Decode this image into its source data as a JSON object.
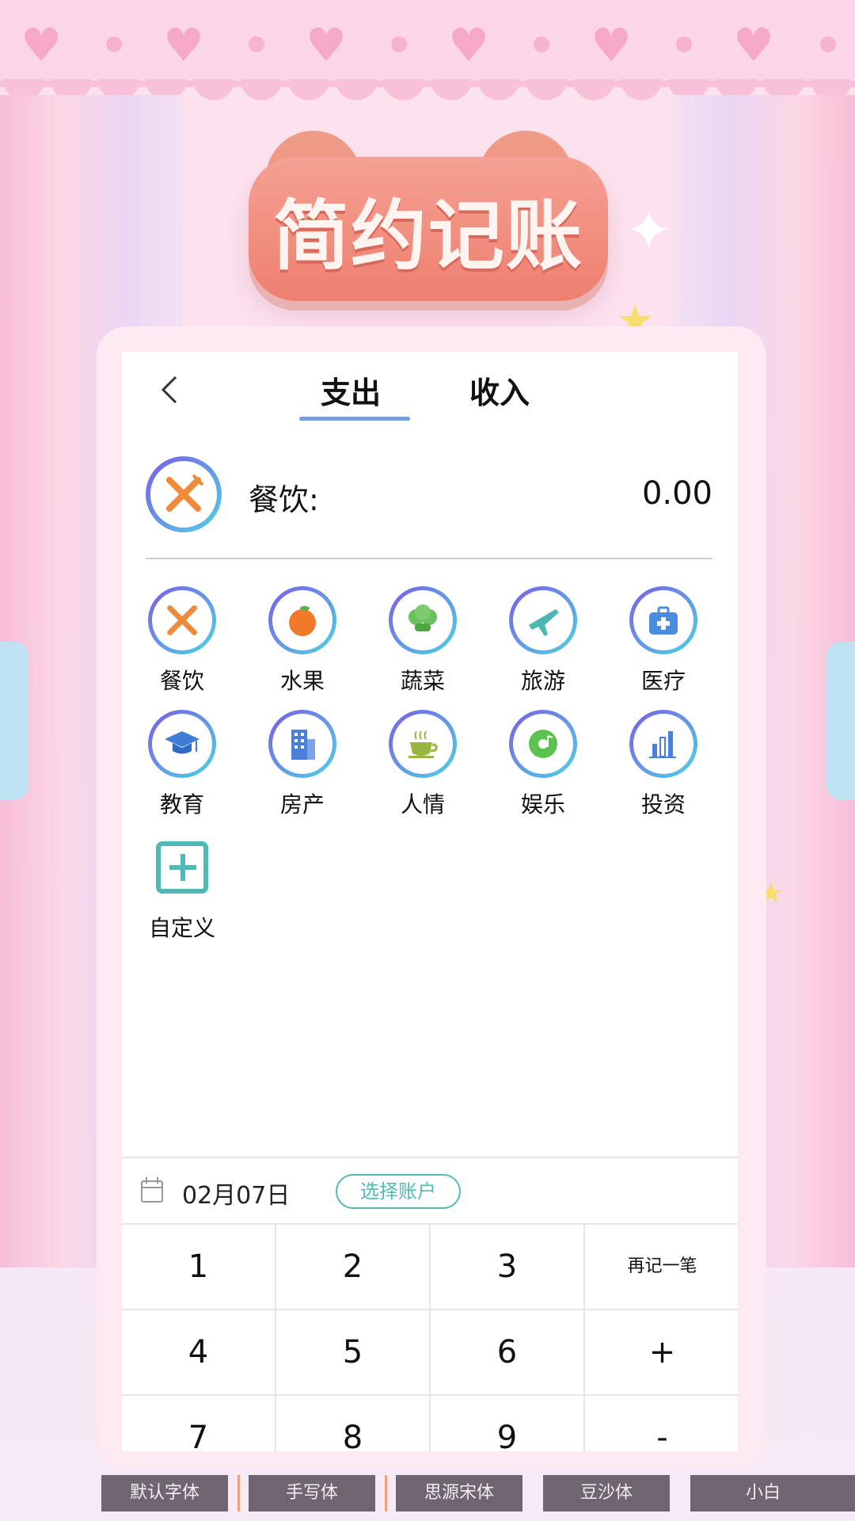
{
  "app": {
    "title": "简约记账"
  },
  "tabs": {
    "expense": "支出",
    "income": "收入",
    "active": "expense"
  },
  "selected": {
    "label": "餐饮:",
    "amount": "0.00",
    "icon": "fork-knife-icon"
  },
  "categories": [
    {
      "label": "餐饮",
      "icon": "fork-knife-icon"
    },
    {
      "label": "水果",
      "icon": "orange-icon"
    },
    {
      "label": "蔬菜",
      "icon": "vegetable-icon"
    },
    {
      "label": "旅游",
      "icon": "airplane-icon"
    },
    {
      "label": "医疗",
      "icon": "medical-kit-icon"
    },
    {
      "label": "教育",
      "icon": "graduation-cap-icon"
    },
    {
      "label": "房产",
      "icon": "building-icon"
    },
    {
      "label": "人情",
      "icon": "tea-cup-icon"
    },
    {
      "label": "娱乐",
      "icon": "music-disc-icon"
    },
    {
      "label": "投资",
      "icon": "bar-chart-icon"
    },
    {
      "label": "自定义",
      "icon": "add-square-icon"
    }
  ],
  "footer": {
    "date": "02月07日",
    "account_button": "选择账户"
  },
  "keypad": {
    "row1": [
      "1",
      "2",
      "3",
      "再记一笔"
    ],
    "row2": [
      "4",
      "5",
      "6",
      "+"
    ],
    "row3": [
      "7",
      "8",
      "9",
      "-"
    ]
  },
  "fonts": [
    "默认字体",
    "手写体",
    "思源宋体",
    "豆沙体",
    "小白"
  ],
  "colors": {
    "accent": "#56b9b3",
    "tab_underline": "#6fa0dc",
    "badge": "#ee7f70"
  }
}
